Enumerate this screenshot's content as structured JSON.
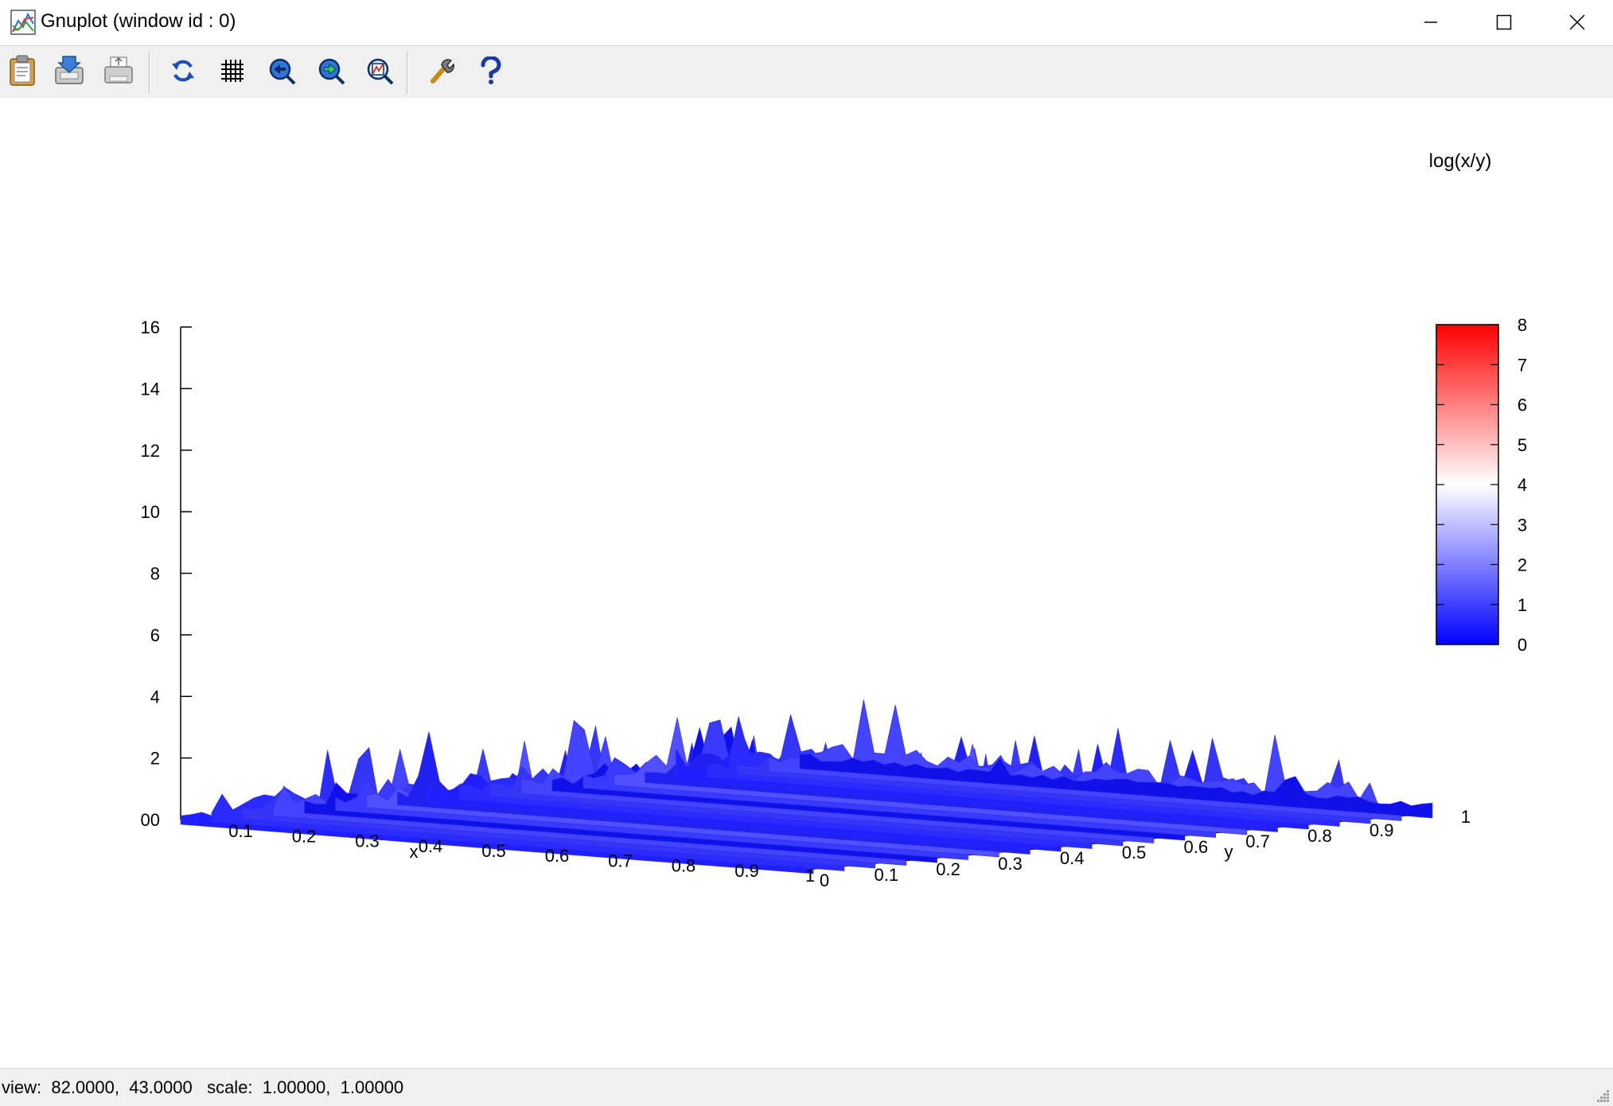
{
  "window": {
    "title": "Gnuplot (window id : 0)"
  },
  "toolbar": {
    "buttons": [
      {
        "name": "copy-clipboard",
        "icon": "clipboard-icon"
      },
      {
        "name": "save",
        "icon": "save-icon"
      },
      {
        "name": "print",
        "icon": "printer-icon"
      },
      {
        "name": "replot",
        "icon": "refresh-icon"
      },
      {
        "name": "grid",
        "icon": "grid-icon"
      },
      {
        "name": "zoom-previous",
        "icon": "zoom-back-icon"
      },
      {
        "name": "zoom-next",
        "icon": "zoom-forward-icon"
      },
      {
        "name": "autoscale",
        "icon": "autoscale-icon"
      },
      {
        "name": "options",
        "icon": "wrench-icon"
      },
      {
        "name": "help",
        "icon": "help-icon"
      }
    ]
  },
  "status": {
    "text": "view:  82.0000,  43.0000   scale:  1.00000,  1.00000"
  },
  "colors": {
    "surface": "#2a2aff",
    "palette_low": "#0000ff",
    "palette_mid": "#ffffff",
    "palette_high": "#ff0000"
  },
  "chart_data": {
    "type": "surface3d",
    "title": "log(x/y)",
    "function": "log(x/y)",
    "xlabel": "x",
    "ylabel": "y",
    "zlabel": "",
    "view": [
      82.0,
      43.0
    ],
    "scale": [
      1.0,
      1.0
    ],
    "x_range": [
      0,
      1
    ],
    "y_range": [
      0,
      1
    ],
    "z_range": [
      0,
      16
    ],
    "x_ticks": [
      "0.1",
      "0.2",
      "0.3",
      "0.4",
      "0.5",
      "0.6",
      "0.7",
      "0.8",
      "0.9",
      "1"
    ],
    "y_ticks": [
      "0",
      "0.1",
      "0.2",
      "0.3",
      "0.4",
      "0.5",
      "0.6",
      "0.7",
      "0.8",
      "0.9",
      "1"
    ],
    "z_ticks": [
      "16",
      "14",
      "12",
      "10",
      "8",
      "6",
      "4",
      "2",
      "00"
    ],
    "colorbox": {
      "range": [
        0,
        8
      ],
      "ticks": [
        "8",
        "7",
        "6",
        "5",
        "4",
        "3",
        "2",
        "1",
        "0"
      ]
    },
    "approx_surface_height": 1.0,
    "approx_surface_peak": 2.5
  }
}
